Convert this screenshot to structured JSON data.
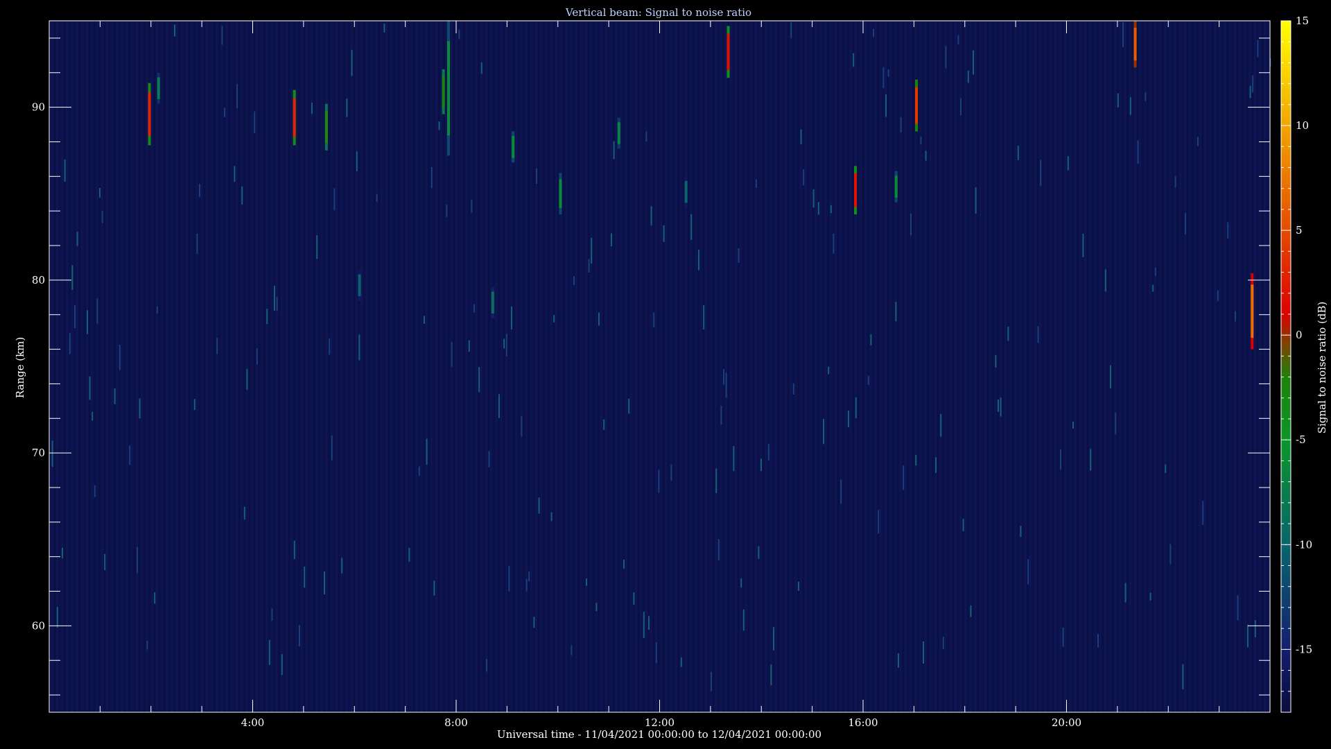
{
  "chart_data": {
    "type": "heatmap",
    "title": "Vertical beam: Signal to noise ratio",
    "xlabel": "Universal time - 11/04/2021 00:00:00 to 12/04/2021 00:00:00",
    "ylabel": "Range (km)",
    "colorbar_label": "Signal to noise ratio (dB)",
    "x_unit": "hours UT",
    "xlim": [
      0,
      24
    ],
    "ylim": [
      55,
      95
    ],
    "clim": [
      -18,
      15
    ],
    "x_ticks": [
      {
        "value": 4,
        "label": "4:00"
      },
      {
        "value": 8,
        "label": "8:00"
      },
      {
        "value": 12,
        "label": "12:00"
      },
      {
        "value": 16,
        "label": "16:00"
      },
      {
        "value": 20,
        "label": "20:00"
      }
    ],
    "y_ticks": [
      {
        "value": 60,
        "label": "60"
      },
      {
        "value": 70,
        "label": "70"
      },
      {
        "value": 80,
        "label": "80"
      },
      {
        "value": 90,
        "label": "90"
      }
    ],
    "cbar_ticks": [
      {
        "value": 15,
        "label": "15"
      },
      {
        "value": 10,
        "label": "10"
      },
      {
        "value": 5,
        "label": "5"
      },
      {
        "value": 0,
        "label": "0"
      },
      {
        "value": -5,
        "label": "-5"
      },
      {
        "value": -10,
        "label": "-10"
      },
      {
        "value": -15,
        "label": "-15"
      }
    ],
    "background_snr_db": -17,
    "echoes": [
      {
        "time": 1.97,
        "range_top": 91.4,
        "range_bottom": 87.8,
        "snr_db": 3
      },
      {
        "time": 2.15,
        "range_top": 92.0,
        "range_bottom": 90.2,
        "snr_db": -8
      },
      {
        "time": 4.82,
        "range_top": 91.0,
        "range_bottom": 87.8,
        "snr_db": 3
      },
      {
        "time": 5.45,
        "range_top": 90.2,
        "range_bottom": 87.5,
        "snr_db": -3
      },
      {
        "time": 6.1,
        "range_top": 80.6,
        "range_bottom": 78.8,
        "snr_db": -10
      },
      {
        "time": 7.75,
        "range_top": 92.2,
        "range_bottom": 89.6,
        "snr_db": -2
      },
      {
        "time": 7.85,
        "range_top": 95.0,
        "range_bottom": 87.2,
        "snr_db": -6
      },
      {
        "time": 8.72,
        "range_top": 79.6,
        "range_bottom": 77.8,
        "snr_db": -9
      },
      {
        "time": 9.12,
        "range_top": 88.6,
        "range_bottom": 86.8,
        "snr_db": -6
      },
      {
        "time": 10.05,
        "range_top": 86.2,
        "range_bottom": 83.8,
        "snr_db": -6
      },
      {
        "time": 11.2,
        "range_top": 89.4,
        "range_bottom": 87.6,
        "snr_db": -7
      },
      {
        "time": 12.52,
        "range_top": 86.0,
        "range_bottom": 84.2,
        "snr_db": -10
      },
      {
        "time": 13.35,
        "range_top": 94.7,
        "range_bottom": 91.7,
        "snr_db": 2
      },
      {
        "time": 15.85,
        "range_top": 86.6,
        "range_bottom": 83.8,
        "snr_db": 2
      },
      {
        "time": 16.65,
        "range_top": 86.3,
        "range_bottom": 84.5,
        "snr_db": -6
      },
      {
        "time": 17.05,
        "range_top": 91.6,
        "range_bottom": 88.6,
        "snr_db": 4
      },
      {
        "time": 21.35,
        "range_top": 95.0,
        "range_bottom": 92.3,
        "snr_db": 6
      },
      {
        "time": 23.65,
        "range_top": 80.4,
        "range_bottom": 76.0,
        "snr_db": 7
      }
    ]
  }
}
